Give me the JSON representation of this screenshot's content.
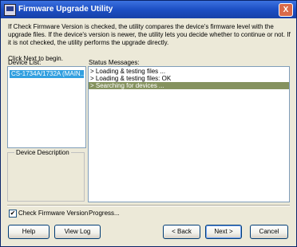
{
  "window": {
    "title": "Firmware Upgrade Utility",
    "close_symbol": "X"
  },
  "intro": {
    "text": "If Check Firmware Version is checked, the utility compares the device's firmware level with the upgrade files. If the device's version is newer, the utility lets you decide whether to continue or not. If it is not checked, the utility performs the upgrade directly.",
    "next_note": "Click Next to begin."
  },
  "device_list": {
    "label": "Device List:",
    "items": [
      "CS-1734A/1732A (MAIN..."
    ]
  },
  "device_description": {
    "label": "Device Description"
  },
  "status": {
    "label": "Status Messages:",
    "messages": [
      "> Loading & testing files ...",
      "> Loading & testing files: OK",
      "> Searching for devices ..."
    ]
  },
  "check_firmware": {
    "checked": true,
    "check_mark": "✔",
    "label": "Check Firmware Version"
  },
  "progress": {
    "label": "Progress..."
  },
  "buttons": {
    "help": "Help",
    "view_log": "View Log",
    "back": "< Back",
    "next": "Next >",
    "cancel": "Cancel"
  }
}
